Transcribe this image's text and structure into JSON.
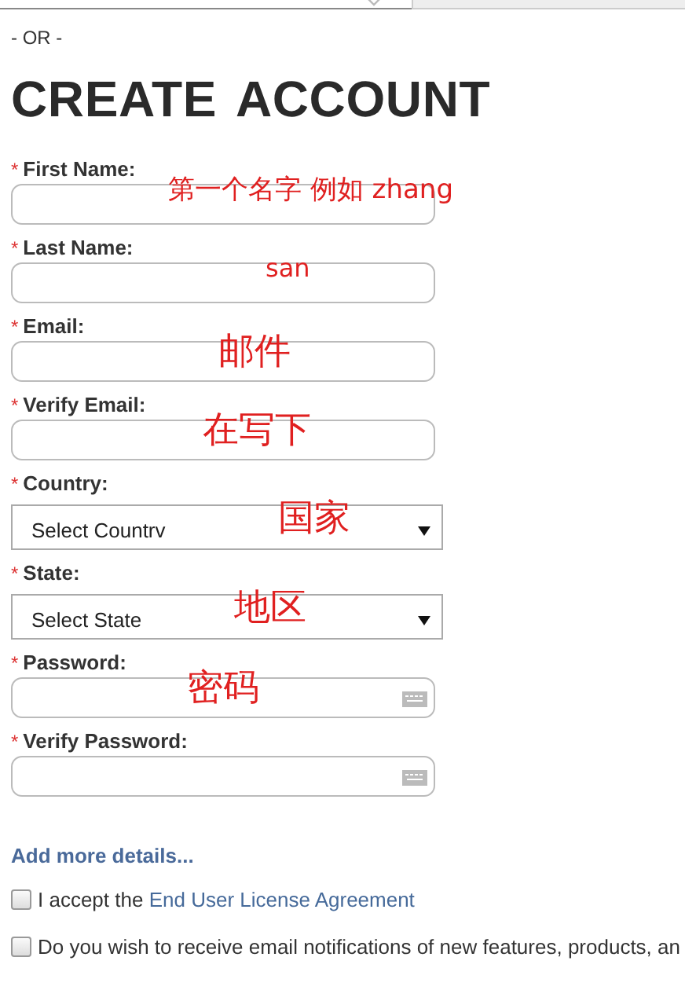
{
  "divider_text": "- OR -",
  "title": "CREATE ACCOUNT",
  "fields": [
    {
      "kind": "text",
      "marker": "*",
      "label": "First Name:",
      "note": "第一个名字  例如 zhang"
    },
    {
      "kind": "text",
      "marker": "*",
      "label": "Last Name:",
      "note": "san"
    },
    {
      "kind": "text",
      "marker": "*",
      "label": "Email:",
      "note": "邮件"
    },
    {
      "kind": "text",
      "marker": "*",
      "label": "Verify Email:",
      "note": "在写下"
    },
    {
      "kind": "select",
      "marker": "*",
      "label": "Country:",
      "value": "Select Countrv",
      "note": "国家"
    },
    {
      "kind": "select",
      "marker": "*",
      "label": "State:",
      "value": "Select State",
      "note": "地区"
    },
    {
      "kind": "password",
      "marker": "*",
      "label": "Password:",
      "note": "密码"
    },
    {
      "kind": "password",
      "marker": "*",
      "label": "Verify Password:"
    }
  ],
  "more_link": "Add more details...",
  "checkboxes": [
    {
      "text": "I accept the ",
      "link": "End User License Agreement",
      "checked": false
    },
    {
      "text": "Do you wish to receive email notifications of new features, products, an",
      "checked": false
    }
  ]
}
